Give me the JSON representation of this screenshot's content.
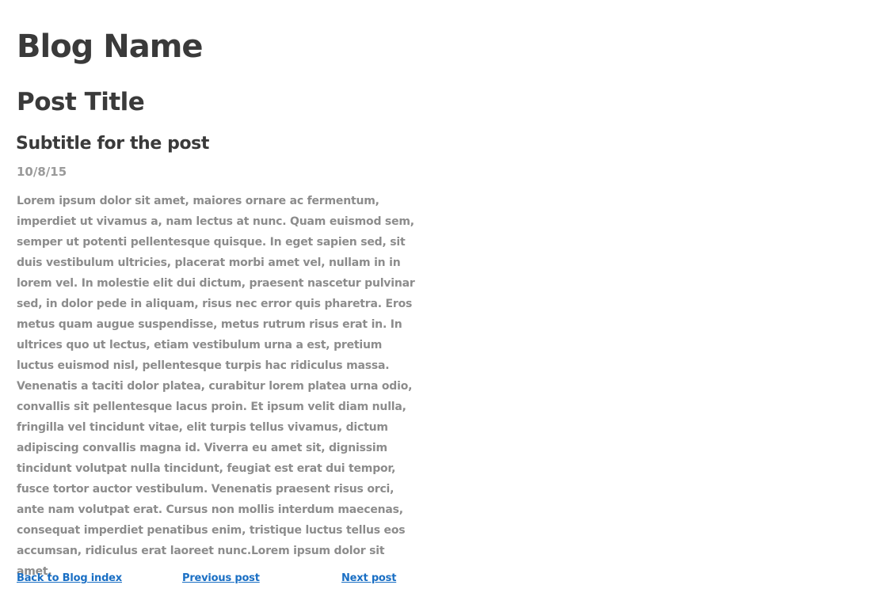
{
  "blog": {
    "name": "Blog Name"
  },
  "post": {
    "title": "Post Title",
    "subtitle": "Subtitle for the post",
    "date": "10/8/15",
    "body": "Lorem ipsum dolor sit amet, maiores ornare ac fermentum, imperdiet ut vivamus a, nam lectus at nunc. Quam euismod sem, semper ut potenti pellentesque quisque. In eget sapien sed, sit duis vestibulum ultricies, placerat morbi amet vel, nullam in in lorem vel. In molestie elit dui dictum, praesent nascetur pulvinar sed, in dolor pede in aliquam, risus nec error quis pharetra.  Eros metus quam augue suspendisse, metus rutrum risus erat in.  In ultrices quo ut lectus, etiam vestibulum urna a est, pretium luctus euismod nisl, pellentesque turpis hac ridiculus massa. Venenatis a taciti dolor platea, curabitur lorem platea urna odio, convallis sit pellentesque lacus proin. Et ipsum velit diam nulla, fringilla vel tincidunt vitae, elit turpis tellus vivamus, dictum adipiscing convallis magna id. Viverra eu amet sit, dignissim tincidunt volutpat nulla tincidunt, feugiat est erat dui tempor, fusce tortor auctor vestibulum. Venenatis praesent risus orci, ante nam volutpat erat. Cursus non mollis interdum maecenas, consequat imperdiet penatibus enim, tristique luctus tellus eos accumsan, ridiculus erat laoreet nunc.Lorem ipsum dolor sit amet,"
  },
  "nav": {
    "back_label": "Back to Blog index",
    "prev_label": "Previous post",
    "next_label": "Next post"
  },
  "colors": {
    "heading": "#3a3a3a",
    "date": "#9a9a9a",
    "body": "#8c8c8c",
    "link": "#1a6fc4"
  }
}
